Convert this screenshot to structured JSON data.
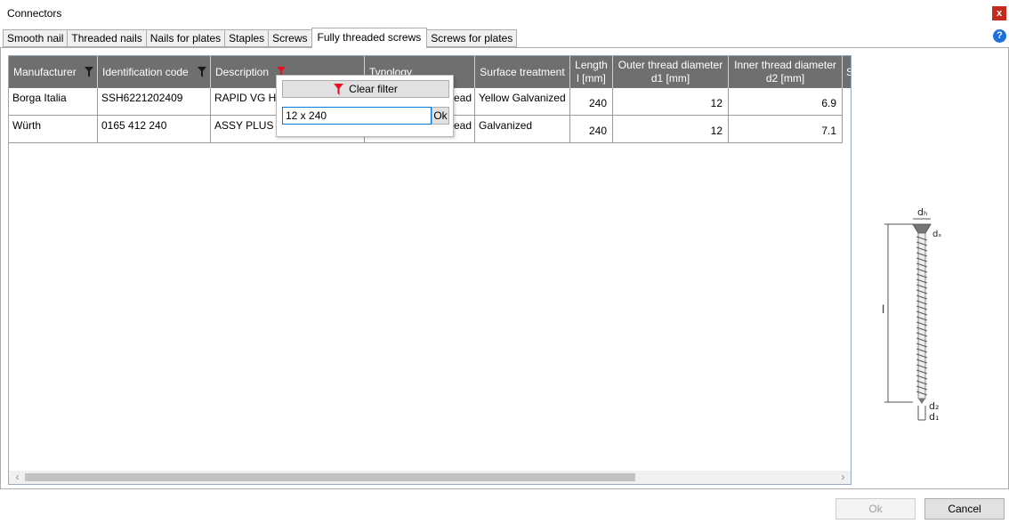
{
  "window": {
    "title": "Connectors",
    "close_label": "x"
  },
  "tabs": [
    {
      "label": "Smooth nail",
      "active": false
    },
    {
      "label": "Threaded nails",
      "active": false
    },
    {
      "label": "Nails for plates",
      "active": false
    },
    {
      "label": "Staples",
      "active": false
    },
    {
      "label": "Screws",
      "active": false
    },
    {
      "label": "Fully threaded screws",
      "active": true
    },
    {
      "label": "Screws for plates",
      "active": false
    }
  ],
  "help_label": "?",
  "grid": {
    "columns": [
      {
        "label": "Manufacturer",
        "filter": "dark"
      },
      {
        "label": "Identification code",
        "filter": "dark"
      },
      {
        "label": "Description",
        "filter": "red"
      },
      {
        "label": "Typology"
      },
      {
        "label": "Surface treatment"
      },
      {
        "label_line1": "Length",
        "label_line2": "l [mm]"
      },
      {
        "label_line1": "Outer thread diameter",
        "label_line2": "d1 [mm]"
      },
      {
        "label_line1": "Inner thread diameter",
        "label_line2": "d2 [mm]"
      },
      {
        "label": "S"
      }
    ],
    "rows": [
      {
        "manufacturer": "Borga Italia",
        "code": "SSH6221202409",
        "description": "RAPID VG HS",
        "typology": "ead",
        "surface": "Yellow Galvanized",
        "length": "240",
        "d1": "12",
        "d2": "6.9"
      },
      {
        "manufacturer": "Würth",
        "code": "0165 412 240",
        "description": "ASSY PLUS VG",
        "typology": "ead",
        "surface": "Galvanized",
        "length": "240",
        "d1": "12",
        "d2": "7.1"
      }
    ]
  },
  "filter_popup": {
    "clear_label": "Clear filter",
    "value": "12 x 240",
    "ok_label": "Ok"
  },
  "diagram": {
    "dh": "dₕ",
    "ds": "dₛ",
    "l": "l",
    "d2": "d₂",
    "d1": "d₁"
  },
  "footer": {
    "ok_label": "Ok",
    "cancel_label": "Cancel"
  },
  "colors": {
    "header_bg": "#6f6f6f",
    "filter_active": "#e81123",
    "accent": "#0078d7"
  }
}
